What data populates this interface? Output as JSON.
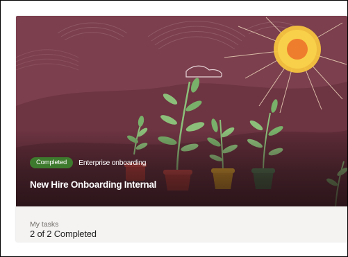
{
  "card": {
    "status_badge": "Completed",
    "category": "Enterprise onboarding",
    "title": "New Hire Onboarding Internal",
    "tasks_label": "My tasks",
    "tasks_value": "2 of 2 Completed"
  },
  "illustration": {
    "background_color": "#7b3f4d",
    "sun_color": "#f6c33e",
    "sun_core_color": "#ef7d2e",
    "leaf_color": "#8cc07a",
    "pot_colors": [
      "#b13a34",
      "#d59a1f",
      "#3f6a43",
      "#8b2e39"
    ]
  },
  "colors": {
    "badge_green": "#3e7a2d",
    "card_background": "#f4f3f2"
  }
}
